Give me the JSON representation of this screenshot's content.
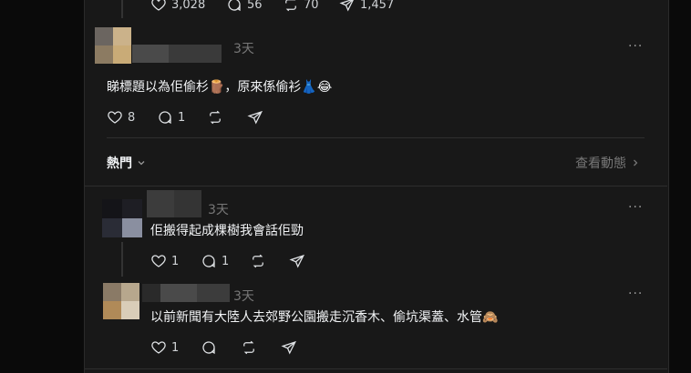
{
  "top_post": {
    "likes": "3,028",
    "comments": "56",
    "reposts": "70",
    "shares": "1,457"
  },
  "comment1": {
    "time": "3天",
    "text": "睇標題以為佢偷杉🪵，原來係偷衫👗😂",
    "likes": "8",
    "replies": "1"
  },
  "sort": {
    "label": "熱門",
    "activity_link": "查看動態"
  },
  "reply1": {
    "time": "3天",
    "text": "佢搬得起成棵樹我會話佢勁",
    "likes": "1",
    "replies": "1"
  },
  "reply2": {
    "time": "3天",
    "text": "以前新聞有大陸人去郊野公園搬走沉香木、偷坑渠蓋、水管🙈",
    "likes": "1"
  },
  "colors": {
    "background": "#0a0a0a",
    "panel": "#181818",
    "text": "#f3f5f7",
    "muted": "#777777"
  }
}
